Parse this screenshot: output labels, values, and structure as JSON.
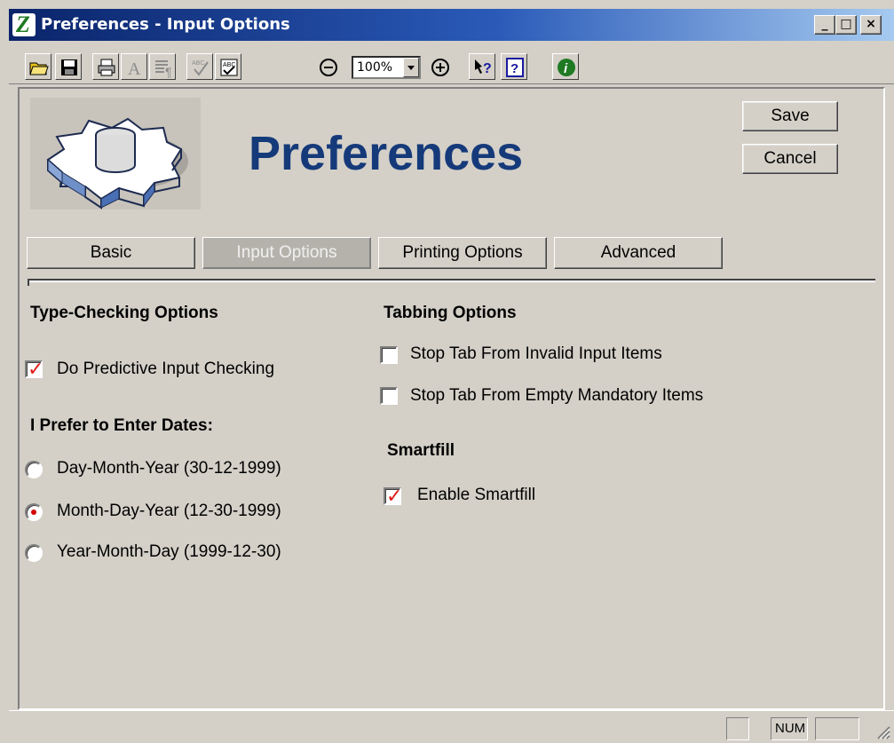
{
  "window": {
    "title": "Preferences - Input Options",
    "controls": {
      "minimize": "_",
      "maximize": "□",
      "close": "×"
    }
  },
  "toolbar": {
    "icons": [
      "open-folder-icon",
      "save-disk-icon",
      "print-icon",
      "font-icon",
      "paragraph-icon",
      "spellcheck-icon",
      "form-check-icon",
      "zoom-out-icon",
      "zoom-in-icon",
      "context-help-icon",
      "help-icon",
      "info-icon"
    ],
    "zoom_value": "100%"
  },
  "header": {
    "title": "Preferences",
    "title_color": "#153a7a",
    "save_label": "Save",
    "cancel_label": "Cancel"
  },
  "tabs": [
    {
      "label": "Basic",
      "active": false
    },
    {
      "label": "Input Options",
      "active": true
    },
    {
      "label": "Printing Options",
      "active": false
    },
    {
      "label": "Advanced",
      "active": false
    }
  ],
  "type_checking": {
    "heading": "Type-Checking Options",
    "predictive": {
      "label": "Do Predictive Input Checking",
      "checked": true
    }
  },
  "dates": {
    "heading": "I Prefer to Enter Dates:",
    "options": [
      {
        "label": "Day-Month-Year (30-12-1999)",
        "selected": false
      },
      {
        "label": "Month-Day-Year (12-30-1999)",
        "selected": true
      },
      {
        "label": "Year-Month-Day (1999-12-30)",
        "selected": false
      }
    ]
  },
  "tabbing": {
    "heading": "Tabbing Options",
    "options": [
      {
        "label": "Stop Tab From Invalid Input Items",
        "checked": false
      },
      {
        "label": "Stop Tab From Empty Mandatory Items",
        "checked": false
      }
    ]
  },
  "smartfill": {
    "heading": "Smartfill",
    "enable": {
      "label": "Enable Smartfill",
      "checked": true
    }
  },
  "statusbar": {
    "num_indicator": "NUM"
  }
}
